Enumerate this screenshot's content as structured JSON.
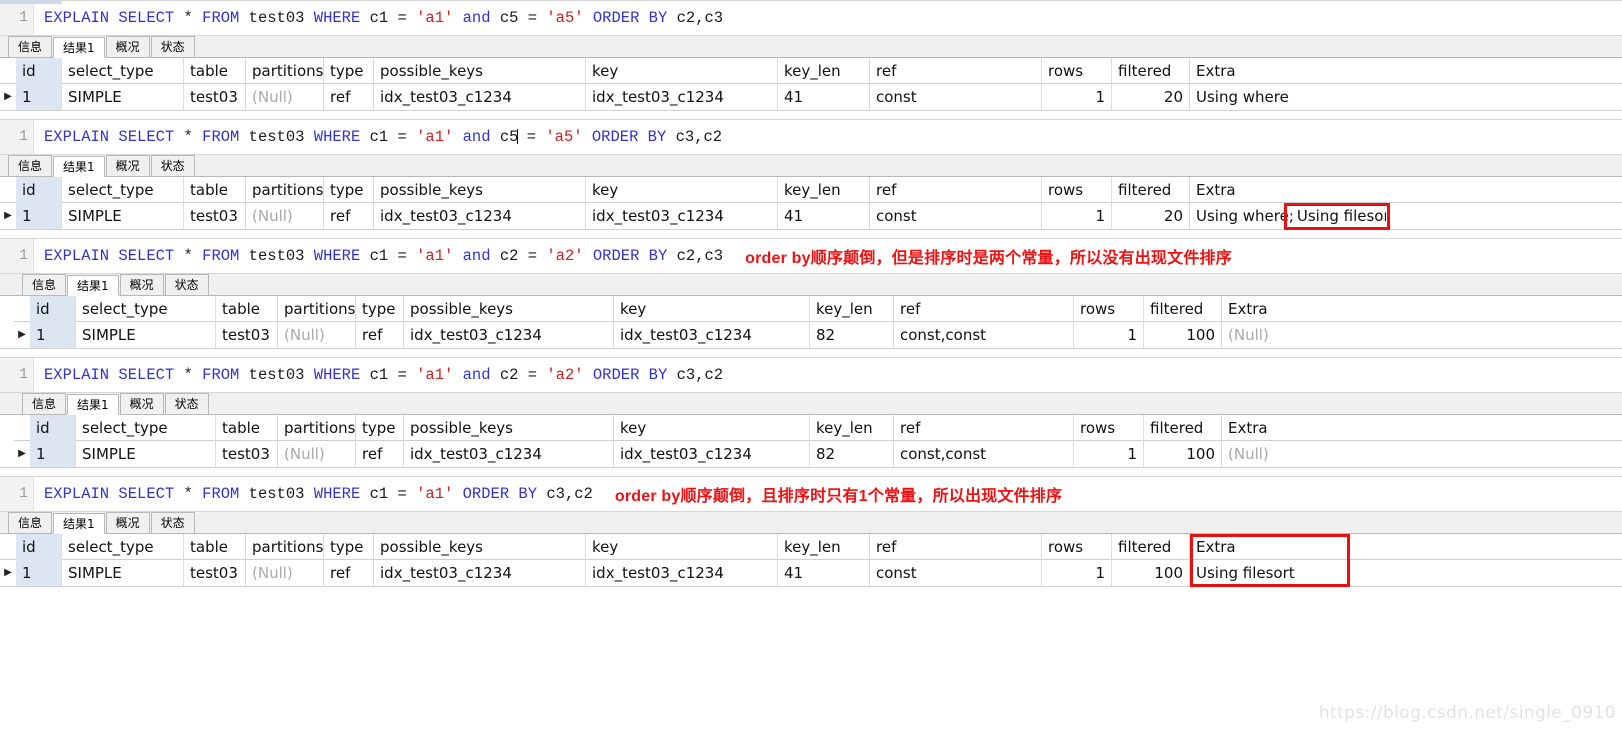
{
  "watermark": "https://blog.csdn.net/single_0910",
  "tabs": [
    {
      "label": "信息",
      "active": false
    },
    {
      "label": "结果1",
      "active": true
    },
    {
      "label": "概况",
      "active": false
    },
    {
      "label": "状态",
      "active": false
    }
  ],
  "columns": [
    "id",
    "select_type",
    "table",
    "partitions",
    "type",
    "possible_keys",
    "key",
    "key_len",
    "ref",
    "rows",
    "filtered",
    "Extra"
  ],
  "line_number": "1",
  "row_marker": "▶",
  "colors": {
    "keyword": "#3333cc",
    "string": "#cc2222",
    "annotation": "#ee1111",
    "highlight_box": "#e81010",
    "id_cell_bg": "#dce6f2",
    "null_text": "#a9a9a9"
  },
  "blocks": [
    {
      "sql_tokens": [
        {
          "t": "EXPLAIN SELECT ",
          "c": "kw"
        },
        {
          "t": "* ",
          "c": "plain"
        },
        {
          "t": "FROM ",
          "c": "kw"
        },
        {
          "t": "test03 ",
          "c": "plain"
        },
        {
          "t": "WHERE ",
          "c": "kw"
        },
        {
          "t": "c1 = ",
          "c": "plain"
        },
        {
          "t": "'a1' ",
          "c": "str"
        },
        {
          "t": "and ",
          "c": "kw"
        },
        {
          "t": "c5 = ",
          "c": "plain"
        },
        {
          "t": "'a5' ",
          "c": "str"
        },
        {
          "t": "ORDER BY ",
          "c": "kw"
        },
        {
          "t": "c2,c3",
          "c": "plain"
        }
      ],
      "sql_plain": "EXPLAIN SELECT * FROM test03 WHERE c1 = 'a1' and c5 = 'a5' ORDER BY c2,c3",
      "annotation": "",
      "caret_after": -1,
      "row": {
        "id": "1",
        "select_type": "SIMPLE",
        "table": "test03",
        "partitions": "(Null)",
        "type": "ref",
        "possible_keys": "idx_test03_c1234",
        "key": "idx_test03_c1234",
        "key_len": "41",
        "ref": "const",
        "rows": "1",
        "filtered": "20",
        "Extra": "Using where"
      },
      "highlight": null
    },
    {
      "sql_tokens": [
        {
          "t": "EXPLAIN SELECT ",
          "c": "kw"
        },
        {
          "t": "* ",
          "c": "plain"
        },
        {
          "t": "FROM ",
          "c": "kw"
        },
        {
          "t": "test03 ",
          "c": "plain"
        },
        {
          "t": "WHERE ",
          "c": "kw"
        },
        {
          "t": "c1 = ",
          "c": "plain"
        },
        {
          "t": "'a1' ",
          "c": "str"
        },
        {
          "t": "and ",
          "c": "kw"
        },
        {
          "t": "c5",
          "c": "plain"
        },
        {
          "t": "CARET",
          "c": "caret"
        },
        {
          "t": " = ",
          "c": "plain"
        },
        {
          "t": "'a5' ",
          "c": "str"
        },
        {
          "t": "ORDER BY ",
          "c": "kw"
        },
        {
          "t": "c3,c2",
          "c": "plain"
        }
      ],
      "sql_plain": "EXPLAIN SELECT * FROM test03 WHERE c1 = 'a1' and c5 = 'a5' ORDER BY c3,c2",
      "annotation": "",
      "row": {
        "id": "1",
        "select_type": "SIMPLE",
        "table": "test03",
        "partitions": "(Null)",
        "type": "ref",
        "possible_keys": "idx_test03_c1234",
        "key": "idx_test03_c1234",
        "key_len": "41",
        "ref": "const",
        "rows": "1",
        "filtered": "20",
        "Extra": "Using where; Using filesort"
      },
      "highlight": {
        "target": "extra-filesort-text",
        "label": "Using filesort"
      }
    },
    {
      "sql_tokens": [
        {
          "t": "EXPLAIN SELECT ",
          "c": "kw"
        },
        {
          "t": "* ",
          "c": "plain"
        },
        {
          "t": "FROM ",
          "c": "kw"
        },
        {
          "t": "test03 ",
          "c": "plain"
        },
        {
          "t": "WHERE ",
          "c": "kw"
        },
        {
          "t": "c1 = ",
          "c": "plain"
        },
        {
          "t": "'a1' ",
          "c": "str"
        },
        {
          "t": "and ",
          "c": "kw"
        },
        {
          "t": "c2 = ",
          "c": "plain"
        },
        {
          "t": "'a2' ",
          "c": "str"
        },
        {
          "t": "ORDER BY ",
          "c": "kw"
        },
        {
          "t": "c2,c3",
          "c": "plain"
        }
      ],
      "sql_plain": "EXPLAIN SELECT * FROM test03 WHERE c1 = 'a1' and c2 = 'a2' ORDER BY c2,c3",
      "annotation": "order by顺序颠倒，但是排序时是两个常量，所以没有出现文件排序",
      "row": {
        "id": "1",
        "select_type": "SIMPLE",
        "table": "test03",
        "partitions": "(Null)",
        "type": "ref",
        "possible_keys": "idx_test03_c1234",
        "key": "idx_test03_c1234",
        "key_len": "82",
        "ref": "const,const",
        "rows": "1",
        "filtered": "100",
        "Extra": "(Null)"
      },
      "highlight": null
    },
    {
      "sql_tokens": [
        {
          "t": "EXPLAIN SELECT ",
          "c": "kw"
        },
        {
          "t": "* ",
          "c": "plain"
        },
        {
          "t": "FROM ",
          "c": "kw"
        },
        {
          "t": "test03 ",
          "c": "plain"
        },
        {
          "t": "WHERE ",
          "c": "kw"
        },
        {
          "t": "c1 = ",
          "c": "plain"
        },
        {
          "t": "'a1' ",
          "c": "str"
        },
        {
          "t": "and ",
          "c": "kw"
        },
        {
          "t": "c2 = ",
          "c": "plain"
        },
        {
          "t": "'a2' ",
          "c": "str"
        },
        {
          "t": "ORDER BY ",
          "c": "kw"
        },
        {
          "t": "c3,c2",
          "c": "plain"
        }
      ],
      "sql_plain": "EXPLAIN SELECT * FROM test03 WHERE c1 = 'a1' and c2 = 'a2' ORDER BY c3,c2",
      "annotation": "",
      "row": {
        "id": "1",
        "select_type": "SIMPLE",
        "table": "test03",
        "partitions": "(Null)",
        "type": "ref",
        "possible_keys": "idx_test03_c1234",
        "key": "idx_test03_c1234",
        "key_len": "82",
        "ref": "const,const",
        "rows": "1",
        "filtered": "100",
        "Extra": "(Null)"
      },
      "highlight": null
    },
    {
      "sql_tokens": [
        {
          "t": "EXPLAIN SELECT ",
          "c": "kw"
        },
        {
          "t": "* ",
          "c": "plain"
        },
        {
          "t": "FROM ",
          "c": "kw"
        },
        {
          "t": "test03 ",
          "c": "plain"
        },
        {
          "t": "WHERE ",
          "c": "kw"
        },
        {
          "t": "c1 = ",
          "c": "plain"
        },
        {
          "t": "'a1' ",
          "c": "str"
        },
        {
          "t": "ORDER BY ",
          "c": "kw"
        },
        {
          "t": "c3,c2",
          "c": "plain"
        }
      ],
      "sql_plain": "EXPLAIN SELECT * FROM test03 WHERE c1 = 'a1' ORDER BY c3,c2",
      "annotation": "order by顺序颠倒，且排序时只有1个常量，所以出现文件排序",
      "row": {
        "id": "1",
        "select_type": "SIMPLE",
        "table": "test03",
        "partitions": "(Null)",
        "type": "ref",
        "possible_keys": "idx_test03_c1234",
        "key": "idx_test03_c1234",
        "key_len": "41",
        "ref": "const",
        "rows": "1",
        "filtered": "100",
        "Extra": "Using filesort"
      },
      "highlight": {
        "target": "extra-column",
        "label": "Extra"
      }
    }
  ]
}
